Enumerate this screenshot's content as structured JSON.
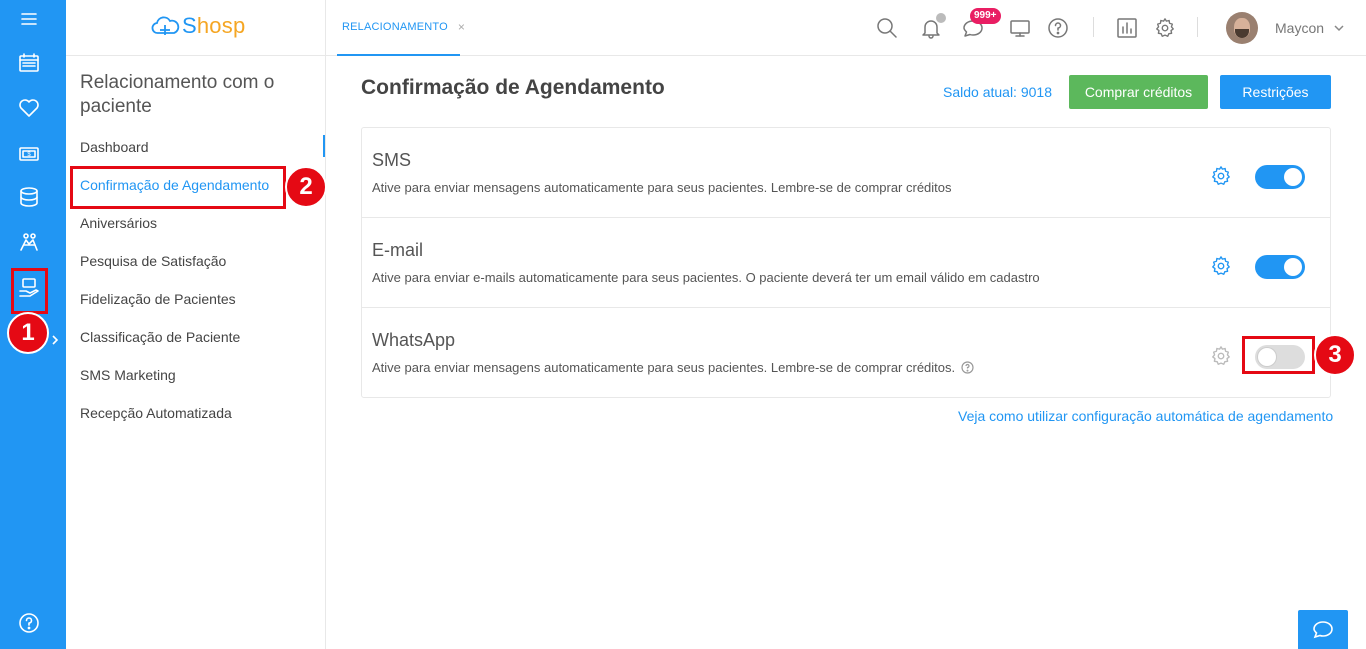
{
  "brand": {
    "name_first": "S",
    "name_rest": "hosp",
    "primary_color": "#2196f3",
    "accent_color": "#f5a623"
  },
  "rail": {
    "icons": [
      "menu-icon",
      "calendar-icon",
      "heart-icon",
      "money-icon",
      "database-icon",
      "team-icon",
      "relationship-icon",
      "help-icon"
    ]
  },
  "header": {
    "tab_label": "RELACIONAMENTO",
    "tab_close": "×",
    "message_badge": "999+",
    "user_name": "Maycon"
  },
  "submenu": {
    "title": "Relacionamento com o paciente",
    "items": [
      "Dashboard",
      "Confirmação de Agendamento",
      "Aniversários",
      "Pesquisa de Satisfação",
      "Fidelização de Pacientes",
      "Classificação de Paciente",
      "SMS Marketing",
      "Recepção Automatizada"
    ],
    "active_index": 1
  },
  "main": {
    "title": "Confirmação de Agendamento",
    "balance": "Saldo atual: 9018",
    "buy_button": "Comprar créditos",
    "restrictions_button": "Restrições",
    "channels": [
      {
        "title": "SMS",
        "description": "Ative para enviar mensagens automaticamente para seus pacientes. Lembre-se de comprar créditos",
        "enabled": true
      },
      {
        "title": "E-mail",
        "description": "Ative para enviar e-mails automaticamente para seus pacientes. O paciente deverá ter um email válido em cadastro",
        "enabled": true
      },
      {
        "title": "WhatsApp",
        "description": "Ative para enviar mensagens automaticamente para seus pacientes. Lembre-se de comprar créditos.",
        "enabled": false
      }
    ],
    "help_link": "Veja como utilizar configuração automática de agendamento"
  },
  "annotations": {
    "step1": "1",
    "step2": "2",
    "step3": "3",
    "color": "#e50914"
  }
}
